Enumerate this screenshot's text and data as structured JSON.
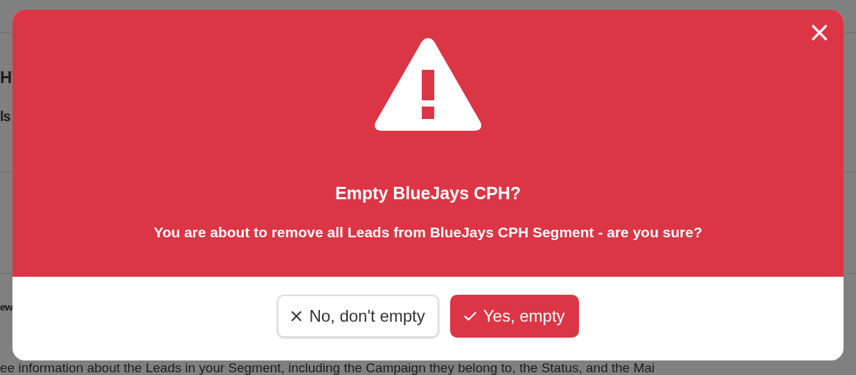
{
  "background": {
    "texts": [
      "H",
      "ls",
      "ew"
    ],
    "description": "ee information about the Leads in your Segment, including the Campaign they belong to, the Status, and the Mai"
  },
  "dialog": {
    "close_label": "×",
    "title": "Empty BlueJays CPH?",
    "message": "You are about to remove all Leads from BlueJays CPH Segment - are you sure?",
    "buttons": [
      {
        "label": "No, don't empty",
        "kind": "cancel"
      },
      {
        "label": "Yes, empty",
        "kind": "confirm"
      }
    ]
  }
}
